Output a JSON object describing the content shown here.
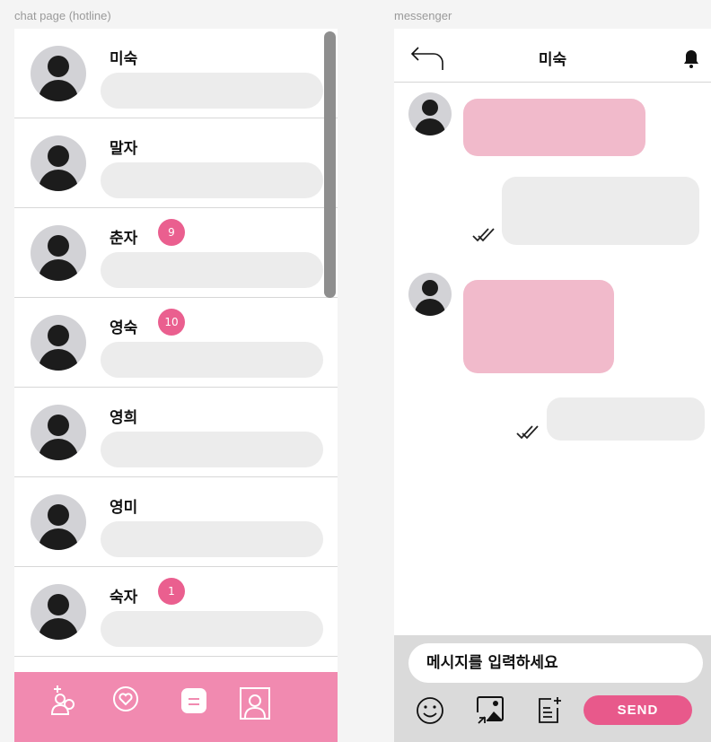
{
  "frames": {
    "left_label": "chat page (hotline)",
    "right_label": "messenger"
  },
  "chat_list": [
    {
      "name": "미숙",
      "badge": null
    },
    {
      "name": "말자",
      "badge": null
    },
    {
      "name": "춘자",
      "badge": "9"
    },
    {
      "name": "영숙",
      "badge": "10"
    },
    {
      "name": "영희",
      "badge": null
    },
    {
      "name": "영미",
      "badge": null
    },
    {
      "name": "숙자",
      "badge": "1"
    }
  ],
  "bottom_nav": {
    "items": [
      "people-search-icon",
      "heart-icon",
      "chat-icon",
      "profile-icon"
    ],
    "active": "chat-icon",
    "background": "#f18ab0"
  },
  "messenger": {
    "title": "미숙",
    "input_placeholder": "메시지를 입력하세요",
    "send_label": "SEND",
    "tools": [
      "emoji-icon",
      "image-icon",
      "note-add-icon"
    ],
    "incoming_color": "#f1bacb",
    "outgoing_color": "#ececec",
    "accent": "#e8598b"
  }
}
